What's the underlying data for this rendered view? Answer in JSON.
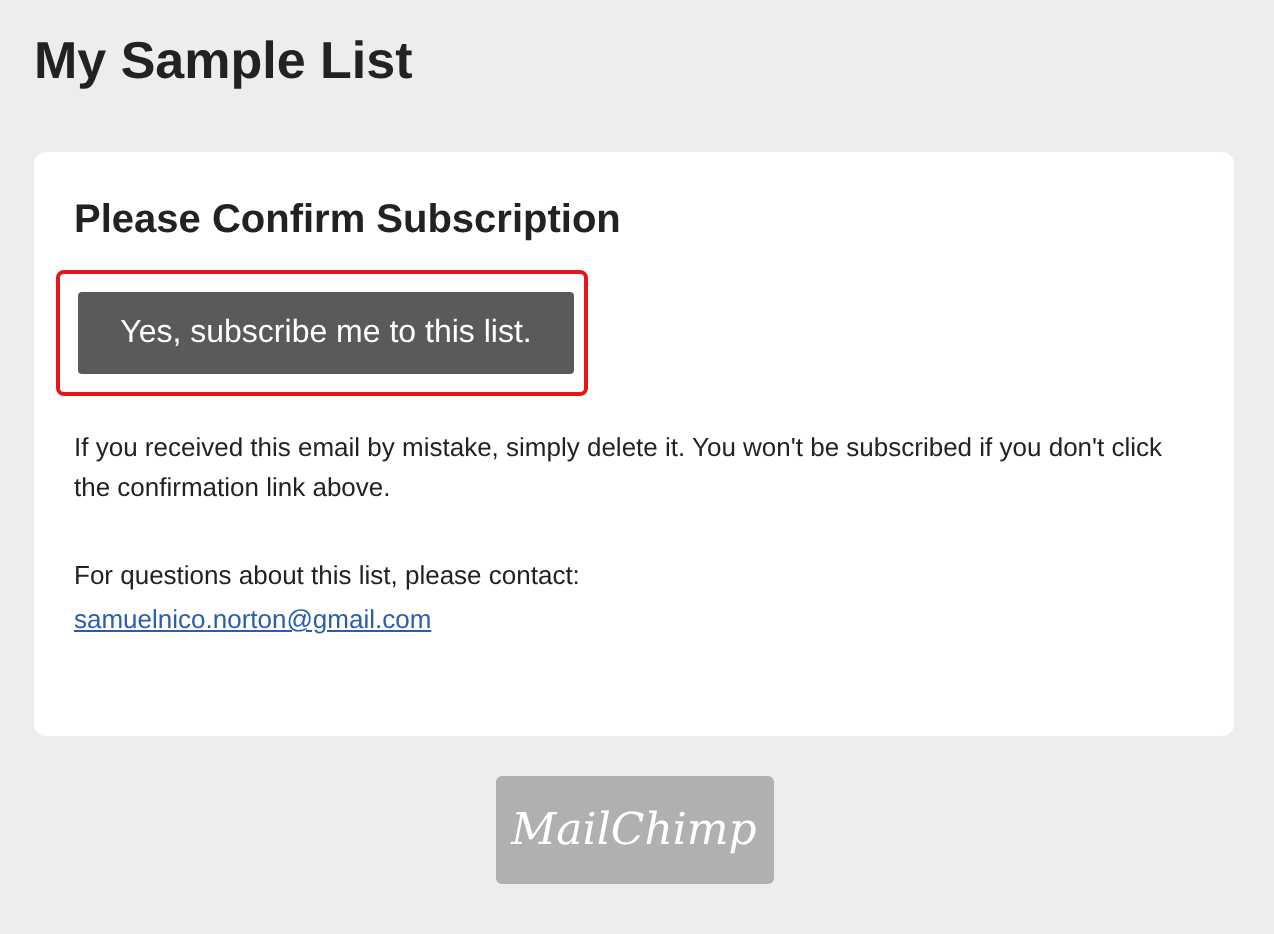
{
  "page_title": "My Sample List",
  "card": {
    "heading": "Please Confirm Subscription",
    "button": {
      "label": "Yes, subscribe me to this list.",
      "highlighted": true
    },
    "notice": "If you received this email by mistake, simply delete it. You won't be subscribed if you don't click the confirmation link above.",
    "contact_text": "For questions about this list, please contact:",
    "contact_email": "samuelnico.norton@gmail.com"
  },
  "footer_logo": "MailChimp"
}
